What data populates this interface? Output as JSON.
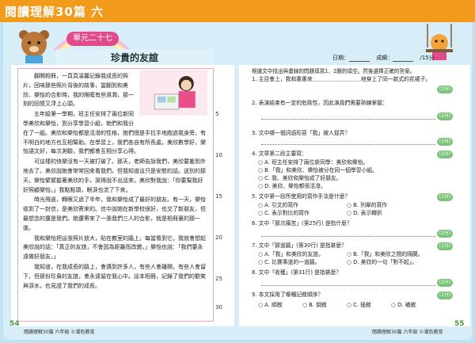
{
  "header": {
    "book_title": "閱讀理解30篇 六",
    "unit": "單元二十七",
    "lesson_title": "珍貴的友誼",
    "meta_date": "日期：",
    "meta_score": "成績：",
    "meta_total": "/15分"
  },
  "passage": {
    "paragraphs": [
      "翻開相冊，一頁頁溫馨記錄我成長的照片，回味那些照片背後的故事，當翻到和美欣、樂怡的合影時，我的眼眶有些濕潤，那一刻的回憶又浮上心頭。",
      "五年級第一學期，班主任安排了兩位新同學美欣和樂怡，到分享學習小組，她們和我分在了一組。美欣和樂怡都是活潑的性格，她們總是手拉手地跑過我身旁，有不明白的地方也互相幫助。在學習上，我們各自有所長處，美欣數學好，樂怡語文好，每次測驗，我們都會互相分享心得。",
      "可這樣的快樂沒有一天被打破了。那天，老師告訴我們，美欣要搬到外地去了。美欣說她會常常回來看我們，但我知道這只是安慰的話。送別的那天，樂怡緊緊握著美欣的手，哭得說不出話來。美欣對我說：「你要幫我好好照顧樂怡。」我點點頭，眼淚也流了下來。",
      "時光飛逝，轉眼又過了半年，我和樂怡成了最好的朋友。有一天，樂怡收到了一封信，是美欣寄來的。信中說她在新學校很好，也交了新朋友，但最想念的還是我們。她還寄來了一張我們三人的合影，就是相冊裏的那一張。",
      "我和樂怡把這張照片放大，貼在教室的牆上。每當看到它，我就會想起美欣說的話：「真正的友誼，不會因為距離而改變。」樂怡也說：「我們要永遠做好朋友。」",
      "我知道，在我成長的路上，會遇到許多人，有些人會離開，有些人會留下，但那份珍貴的友誼，會永遠留在我心中。這本相冊，記錄了我們的歡笑與淚水，也見證了我們的成長。"
    ]
  },
  "line_numbers": [
    "5",
    "10",
    "15",
    "20",
    "25",
    "30"
  ],
  "instructions": "根據文中找出與畫線的問題填寫1、2題的填空。然後選擇正確的答案。",
  "questions": [
    {
      "num": "1.",
      "text": "主目會上，我和惠惠來＿＿＿＿＿＿＿＿＿地穿上了同一款式的花裙子。",
      "score": "(2分)"
    },
    {
      "num": "2.",
      "text": "表演結束有一定的危險性，因此演員們需要熟練掌握：",
      "score": "(2分)"
    },
    {
      "num": "3.",
      "text": "文中哪一個詞語形容「我」被人捉弄？",
      "score": "(1分)"
    },
    {
      "num": "4.",
      "text": "文章第二段主要寫：",
      "score": "(1分)",
      "options": [
        "A. 班主任安排了兩位新同學：美欣和樂怡。",
        "B.「我」和美欣、樂怡被分在同一個學習小組。",
        "C. 我、美欣和樂怡成了好朋友。",
        "D. 美欣、樂怡都很活潑。"
      ]
    },
    {
      "num": "5.",
      "text": "文中第一段所使用的寫作手法是什麼？",
      "score": "(1分)",
      "options": [
        "A. 引文的寫作",
        "B. 列舉的寫作",
        "C. 表示對比的寫作",
        "D. 表示轉折"
      ]
    },
    {
      "num": "6.",
      "text": "文中「那次痛苦」(第25行) 是指什麼？",
      "score": "(2分)"
    },
    {
      "num": "7.",
      "text": "文中「那道牆」(第30行) 是指甚麼？",
      "score": "(1分)",
      "options": [
        "A.「我」和美欣的友誼。",
        "B.「我」和美欣之間的隔閡。",
        "C. 比賽事道的一道牆。",
        "D. 美欣的一句「對不起」。"
      ]
    },
    {
      "num": "8.",
      "text": "文中「收穫」(第31行) 是指甚麼？",
      "score": "(2分)"
    },
    {
      "num": "9.",
      "text": "本文採用了哪種記敘順序？",
      "score": "(1分)",
      "options": [
        "A. 順敘",
        "B. 倒敘",
        "C. 插敘",
        "D. 補敘"
      ]
    }
  ],
  "footer": {
    "left": "閱讀理解30篇  六年級  ©潮色教育",
    "right": "閱讀理解30篇  六年級  ©潮色教育",
    "page_left": "54",
    "page_right": "55"
  },
  "colors": {
    "accent": "#f29a1a",
    "unit_badge": "#e24a8a",
    "score_badge": "#7bc37a"
  }
}
